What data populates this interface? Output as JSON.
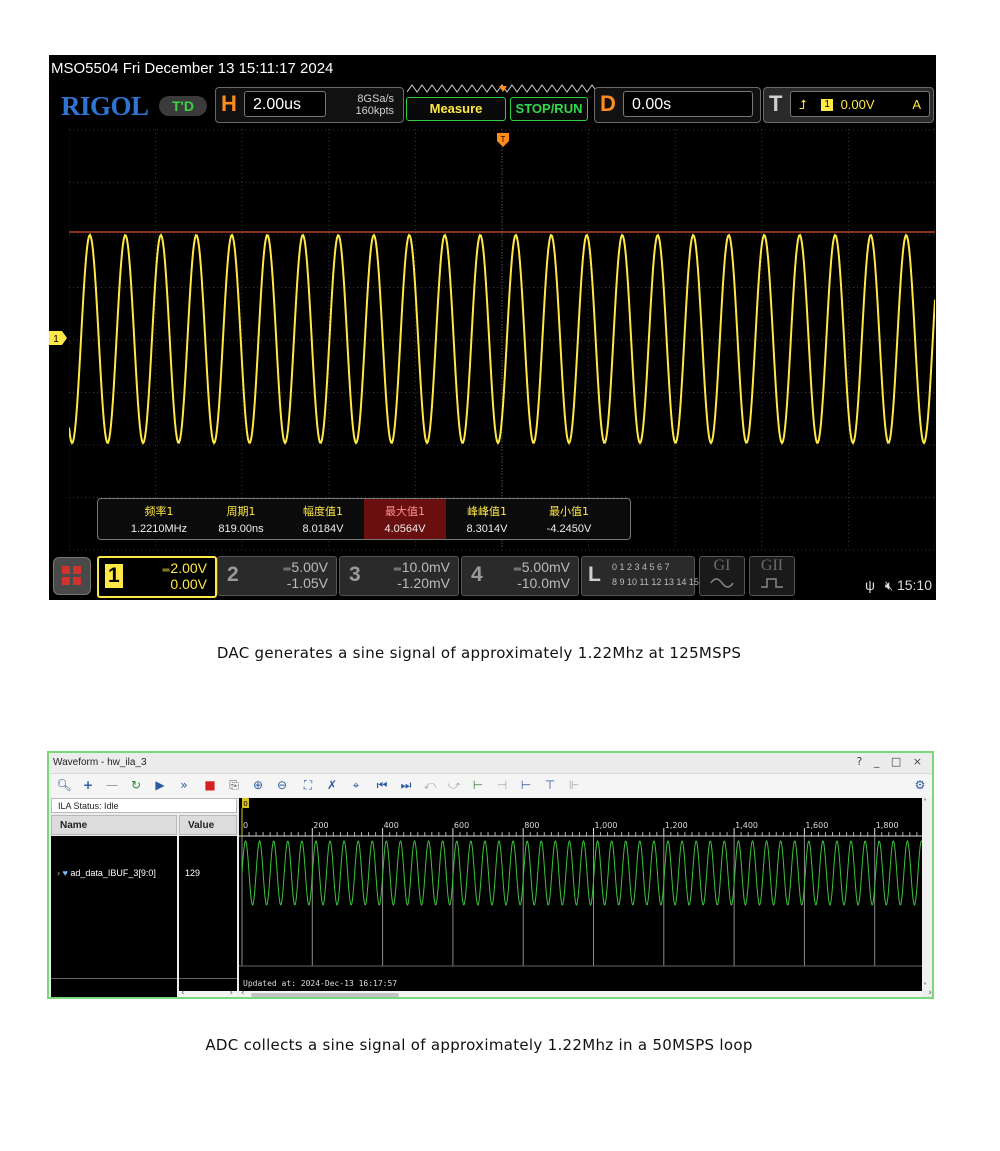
{
  "scope": {
    "title": "MSO5504  Fri December 13 15:11:17 2024",
    "logo": "RIGOL",
    "td_label": "T'D",
    "horizontal": {
      "letter": "H",
      "timebase": "2.00us",
      "sample_rate": "8GSa/s",
      "memory_depth": "160kpts"
    },
    "buttons": {
      "measure": "Measure",
      "stop_run": "STOP/RUN"
    },
    "delay": {
      "letter": "D",
      "value": "0.00s"
    },
    "trigger": {
      "letter": "T",
      "source": "1",
      "level": "0.00V",
      "mode": "A"
    },
    "ch1_marker": "1",
    "trigger_marker": "T",
    "waveform": {
      "cycles": 24.4,
      "amplitude_fraction": 0.86,
      "color": "#ffe845"
    },
    "measurements": [
      {
        "label": "频率1",
        "value": "1.2210MHz",
        "highlight": false
      },
      {
        "label": "周期1",
        "value": "819.00ns",
        "highlight": false
      },
      {
        "label": "幅度值1",
        "value": "8.0184V",
        "highlight": false
      },
      {
        "label": "最大值1",
        "value": "4.0564V",
        "highlight": true
      },
      {
        "label": "峰峰值1",
        "value": "8.3014V",
        "highlight": false
      },
      {
        "label": "最小值1",
        "value": "-4.2450V",
        "highlight": false
      }
    ],
    "channels": [
      {
        "num": "1",
        "scale": "2.00V",
        "offset": "0.00V",
        "color": "#ffe845"
      },
      {
        "num": "2",
        "scale": "5.00V",
        "offset": "-1.05V",
        "color": "#9a9a9a"
      },
      {
        "num": "3",
        "scale": "10.0mV",
        "offset": "-1.20mV",
        "color": "#9a9a9a"
      },
      {
        "num": "4",
        "scale": "5.00mV",
        "offset": "-10.0mV",
        "color": "#9a9a9a"
      }
    ],
    "logic": {
      "letter": "L",
      "row1": "0 1 2 3  4 5 6 7",
      "row2": "8 9 10 11  12 13 14 15"
    },
    "gen_buttons": [
      "GI",
      "GII"
    ],
    "clock": "15:10"
  },
  "caption_top": "DAC generates a sine signal of approximately 1.22Mhz at 125MSPS",
  "vivado": {
    "title": "Waveform - hw_ila_3",
    "window_buttons": "? _ □ ×",
    "ila_status": "ILA Status: Idle",
    "col_name": "Name",
    "col_value": "Value",
    "signal_name": "ad_data_IBUF_3[9:0]",
    "signal_value": "129",
    "ruler_labels": [
      "0",
      "200",
      "400",
      "600",
      "800",
      "1,000",
      "1,200",
      "1,400",
      "1,600",
      "1,800"
    ],
    "trigger_marker": "0",
    "updated": "Updated at: 2024-Dec-13 16:17:57",
    "wave": {
      "cycles": 48.5,
      "samples_visible": 1940,
      "color": "#3cc23c"
    }
  },
  "caption_bottom": "ADC collects a sine signal of approximately 1.22Mhz in a 50MSPS loop"
}
